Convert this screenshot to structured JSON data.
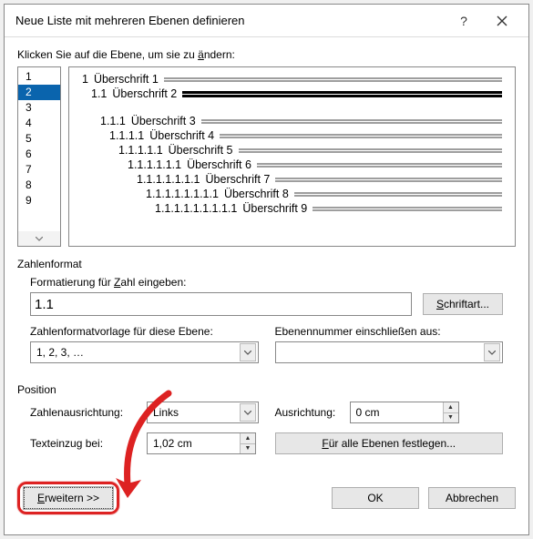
{
  "title": "Neue Liste mit mehreren Ebenen definieren",
  "help_char": "?",
  "instruction": {
    "pre": "Klicken Sie auf die Ebene, um sie zu ",
    "accel": "ä",
    "post": "ndern:"
  },
  "levels": [
    "1",
    "2",
    "3",
    "4",
    "5",
    "6",
    "7",
    "8",
    "9"
  ],
  "selected_level_index": 1,
  "preview": [
    {
      "num": "1",
      "text": "Überschrift 1",
      "selected": false
    },
    {
      "num": "1.1",
      "text": "Überschrift 2",
      "selected": true
    },
    {
      "num": "1.1.1",
      "text": "Überschrift 3",
      "selected": false
    },
    {
      "num": "1.1.1.1",
      "text": "Überschrift 4",
      "selected": false
    },
    {
      "num": "1.1.1.1.1",
      "text": "Überschrift 5",
      "selected": false
    },
    {
      "num": "1.1.1.1.1.1",
      "text": "Überschrift 6",
      "selected": false
    },
    {
      "num": "1.1.1.1.1.1.1",
      "text": "Überschrift 7",
      "selected": false
    },
    {
      "num": "1.1.1.1.1.1.1.1",
      "text": "Überschrift 8",
      "selected": false
    },
    {
      "num": "1.1.1.1.1.1.1.1.1",
      "text": "Überschrift 9",
      "selected": false
    }
  ],
  "numberformat": {
    "section": "Zahlenformat",
    "enter_lbl": {
      "pre": "Formatierung für ",
      "accel": "Z",
      "post": "ahl eingeben:"
    },
    "value": "1.1",
    "font_btn": {
      "accel": "S",
      "post": "chriftart..."
    },
    "style_lbl": "Zahlenformatvorlage für diese Ebene:",
    "style_val": "1, 2, 3, …",
    "include_lbl": "Ebenennummer einschließen aus:",
    "include_val": ""
  },
  "position": {
    "section": "Position",
    "align_lbl": "Zahlenausrichtung:",
    "align_val": "Links",
    "at_lbl": "Ausrichtung:",
    "at_val": "0 cm",
    "indent_lbl": "Texteinzug bei:",
    "indent_val": "1,02 cm",
    "setall_btn": {
      "accel": "F",
      "post": "ür alle Ebenen festlegen..."
    }
  },
  "footer": {
    "expand_btn": {
      "accel": "E",
      "post": "rweitern >>"
    },
    "ok": "OK",
    "cancel": "Abbrechen"
  }
}
